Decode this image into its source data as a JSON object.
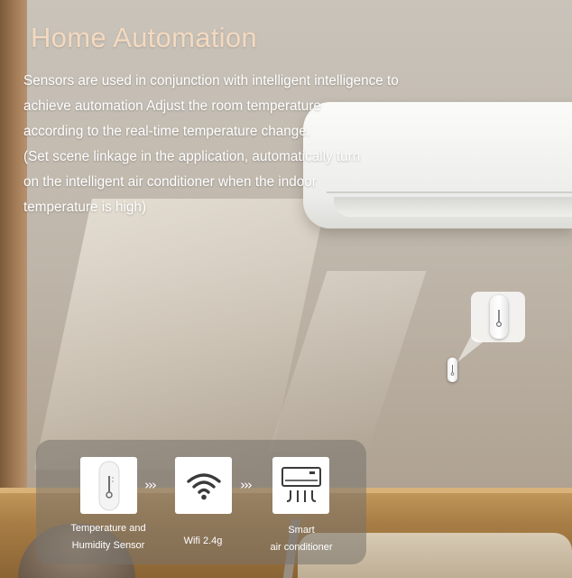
{
  "header": {
    "title": "Home Automation"
  },
  "description": {
    "lines": [
      "Sensors are used in conjunction with intelligent intelligence to",
      "achieve automation Adjust the room temperature",
      "according to the real-time temperature change.",
      "(Set scene linkage in the application, automatically turn",
      "on the intelligent air conditioner when the indoor",
      "temperature is high)"
    ]
  },
  "flow": {
    "arrow": "›››",
    "steps": [
      {
        "icon": "temperature-sensor-icon",
        "label_lines": [
          "Temperature and",
          "Humidity Sensor"
        ]
      },
      {
        "icon": "wifi-icon",
        "label_lines": [
          "Wifi 2.4g"
        ]
      },
      {
        "icon": "air-conditioner-icon",
        "label_lines": [
          "Smart",
          "air conditioner"
        ]
      }
    ]
  },
  "colors": {
    "title": "#f3d9bf",
    "text": "#ffffff",
    "panel": "#78736c"
  }
}
